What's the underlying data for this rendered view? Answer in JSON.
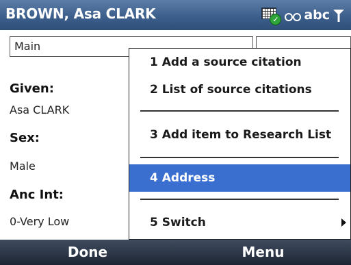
{
  "title_bar": {
    "title": "BROWN, Asa CLARK",
    "input_mode": "abc",
    "icons": [
      "keyboard-check-icon",
      "input-mode-icon",
      "signal-icon"
    ]
  },
  "form": {
    "dropdown_value": "Main",
    "fields": [
      {
        "label": "Given:",
        "value": "Asa CLARK"
      },
      {
        "label": "Sex:",
        "value": "Male"
      },
      {
        "label": "Anc Int:",
        "value": "0-Very Low"
      }
    ]
  },
  "menu": {
    "items": [
      {
        "label": "1 Add a source citation",
        "selected": false
      },
      {
        "label": "2 List of source citations",
        "selected": false
      },
      {
        "label": "3 Add item to Research List",
        "selected": false
      },
      {
        "label": "4 Address",
        "selected": true
      },
      {
        "label": "5 Switch",
        "selected": false,
        "has_submenu": true
      }
    ]
  },
  "softkeys": {
    "left": "Done",
    "right": "Menu"
  },
  "colors": {
    "title_bar": "#3d5f8c",
    "selected": "#3a6fd0",
    "softbar": "#1d2533"
  }
}
